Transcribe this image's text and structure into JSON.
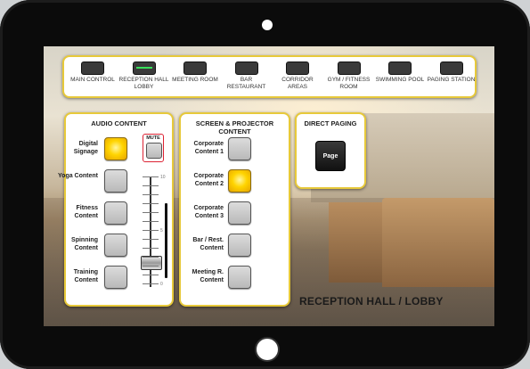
{
  "zones": [
    {
      "label": "MAIN CONTROL",
      "active": false
    },
    {
      "label": "RECEPTION HALL LOBBY",
      "active": true
    },
    {
      "label": "MEETING ROOM",
      "active": false
    },
    {
      "label": "BAR RESTAURANT",
      "active": false
    },
    {
      "label": "CORRIDOR AREAS",
      "active": false
    },
    {
      "label": "GYM / FITNESS ROOM",
      "active": false
    },
    {
      "label": "SWIMMING POOL",
      "active": false
    },
    {
      "label": "PAGING STATION",
      "active": false
    }
  ],
  "audio": {
    "title": "AUDIO CONTENT",
    "items": [
      {
        "label": "Digital Signage",
        "active": true
      },
      {
        "label": "Yoga Content",
        "active": false
      },
      {
        "label": "Fitness Content",
        "active": false
      },
      {
        "label": "Spinning Content",
        "active": false
      },
      {
        "label": "Training Content",
        "active": false
      }
    ],
    "mute_label": "MUTE",
    "scale": [
      "10",
      "5",
      "0"
    ],
    "volume_level": 0.2
  },
  "screen": {
    "title": "SCREEN & PROJECTOR CONTENT",
    "items": [
      {
        "label": "Corporate Content 1",
        "active": false
      },
      {
        "label": "Corporate Content 2",
        "active": true
      },
      {
        "label": "Corporate Content 3",
        "active": false
      },
      {
        "label": "Bar / Rest. Content",
        "active": false
      },
      {
        "label": "Meeting R. Content",
        "active": false
      }
    ]
  },
  "direct": {
    "title": "DIRECT PAGING",
    "page_label": "Page"
  },
  "room_title": "RECEPTION HALL / LOBBY",
  "colors": {
    "accent_border": "#e7c93a",
    "active_button": "#ffd400",
    "mute_border": "#dd2233"
  }
}
